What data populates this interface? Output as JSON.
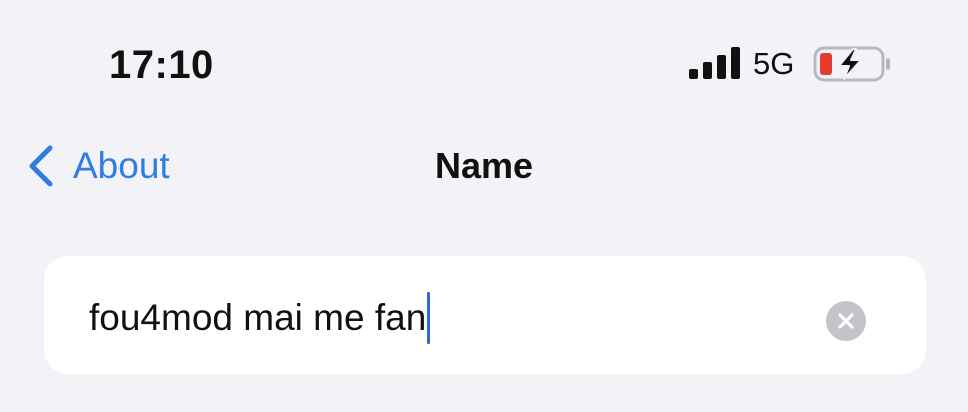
{
  "status_bar": {
    "time": "17:10",
    "network": "5G",
    "battery": {
      "level": 0.15,
      "charging": true,
      "low_color": "#e53a30"
    },
    "signal_bars": 4
  },
  "nav": {
    "back_label": "About",
    "title": "Name",
    "accent_color": "#2f7de1"
  },
  "name_field": {
    "value": "fou4mod mai me fan",
    "clear_icon": "clear-circle-icon"
  }
}
